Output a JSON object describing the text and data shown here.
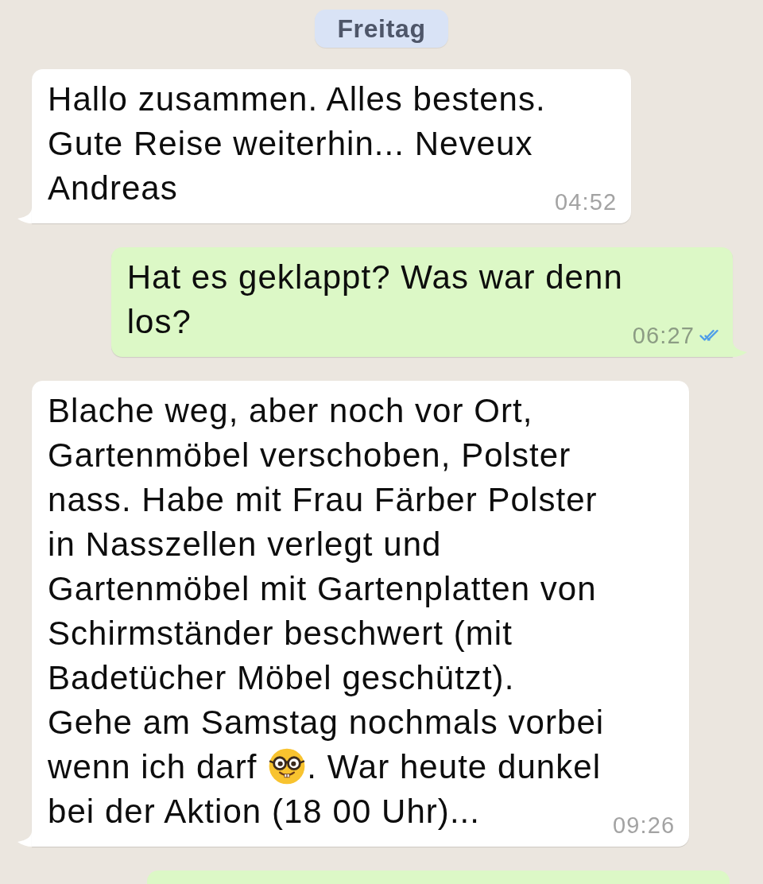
{
  "date_separator": {
    "label": "Freitag"
  },
  "messages": [
    {
      "outgoing": false,
      "parts": [
        {
          "kind": "text",
          "text": "Hallo zusammen. Alles bestens. Gute Reise weiterhin... Neveux Andreas"
        }
      ],
      "time": "04:52"
    },
    {
      "outgoing": true,
      "parts": [
        {
          "kind": "text",
          "text": "Hat es geklappt? Was war denn los?"
        }
      ],
      "time": "06:27",
      "read": true
    },
    {
      "outgoing": false,
      "parts": [
        {
          "kind": "text",
          "text": "Blache weg, aber noch vor Ort, Gartenmöbel verschoben, Polster nass. Habe mit Frau Färber Polster in Nasszellen verlegt und Gartenmöbel mit Gartenplatten von Schirmständer beschwert (mit Badetücher Möbel geschützt). Gehe am Samstag nochmals vorbei wenn ich darf "
        },
        {
          "kind": "emoji"
        },
        {
          "kind": "text",
          "text": ". War heute dunkel bei der Aktion (18 00 Uhr)..."
        }
      ],
      "time": "09:26"
    },
    {
      "outgoing": true
    }
  ]
}
